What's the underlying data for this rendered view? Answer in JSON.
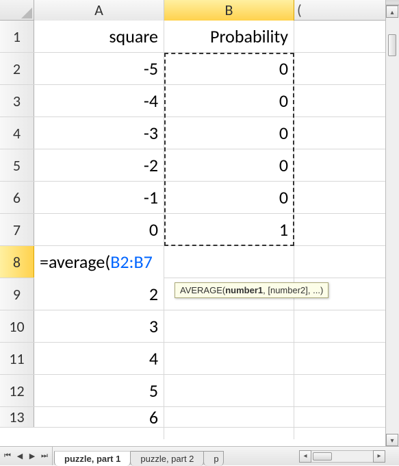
{
  "columns": {
    "A": "A",
    "B": "B",
    "C": "("
  },
  "rows": [
    {
      "num": "1",
      "A": "square",
      "B": "Probability"
    },
    {
      "num": "2",
      "A": "-5",
      "B": "0"
    },
    {
      "num": "3",
      "A": "-4",
      "B": "0"
    },
    {
      "num": "4",
      "A": "-3",
      "B": "0"
    },
    {
      "num": "5",
      "A": "-2",
      "B": "0"
    },
    {
      "num": "6",
      "A": "-1",
      "B": "0"
    },
    {
      "num": "7",
      "A": "0",
      "B": "1"
    },
    {
      "num": "8",
      "A": "",
      "B": ""
    },
    {
      "num": "9",
      "A": "2",
      "B": ""
    },
    {
      "num": "10",
      "A": "3",
      "B": ""
    },
    {
      "num": "11",
      "A": "4",
      "B": ""
    },
    {
      "num": "12",
      "A": "5",
      "B": ""
    },
    {
      "num": "13",
      "A": "6",
      "B": ""
    }
  ],
  "formula": {
    "prefix": "=average(",
    "ref": "B2:B7"
  },
  "tooltip": {
    "fn": "AVERAGE(",
    "arg1": "number1",
    "rest": ", [number2], ...)"
  },
  "tabs": {
    "t1": "puzzle, part 1",
    "t2": "puzzle, part 2",
    "t3": "p"
  },
  "chart_data": {
    "type": "table",
    "columns": [
      "square",
      "Probability"
    ],
    "rows": [
      {
        "square": -5,
        "Probability": 0
      },
      {
        "square": -4,
        "Probability": 0
      },
      {
        "square": -3,
        "Probability": 0
      },
      {
        "square": -2,
        "Probability": 0
      },
      {
        "square": -1,
        "Probability": 0
      },
      {
        "square": 0,
        "Probability": 1
      },
      {
        "square": 2,
        "Probability": null
      },
      {
        "square": 3,
        "Probability": null
      },
      {
        "square": 4,
        "Probability": null
      },
      {
        "square": 5,
        "Probability": null
      },
      {
        "square": 6,
        "Probability": null
      }
    ],
    "active_formula": "=average(B2:B7",
    "active_cell": "A8"
  }
}
